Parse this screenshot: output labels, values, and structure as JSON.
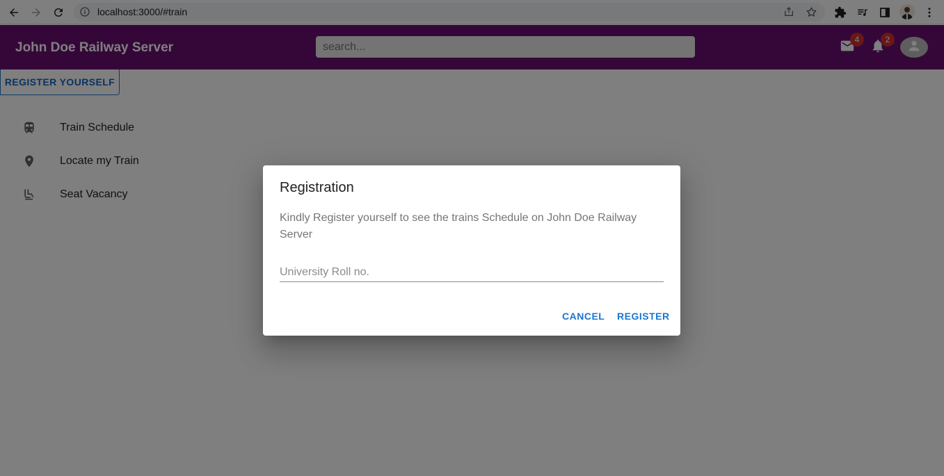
{
  "browser": {
    "url": "localhost:3000/#train"
  },
  "appbar": {
    "title": "John Doe Railway Server",
    "search_placeholder": "search...",
    "mail_count": "4",
    "notification_count": "2"
  },
  "sidebar": {
    "register_label": "REGISTER YOURSELF",
    "items": [
      {
        "label": "Train Schedule",
        "icon": "train-icon"
      },
      {
        "label": "Locate my Train",
        "icon": "location-pin-icon"
      },
      {
        "label": "Seat Vacancy",
        "icon": "seat-icon"
      }
    ]
  },
  "dialog": {
    "title": "Registration",
    "text": "Kindly Register yourself to see the trains Schedule on John Doe Railway Server",
    "field_placeholder": "University Roll no.",
    "field_value": "",
    "cancel_label": "CANCEL",
    "register_label": "REGISTER"
  },
  "colors": {
    "appbar": "#6a0f72",
    "accent": "#1976d2",
    "badge": "#d32f2f"
  }
}
